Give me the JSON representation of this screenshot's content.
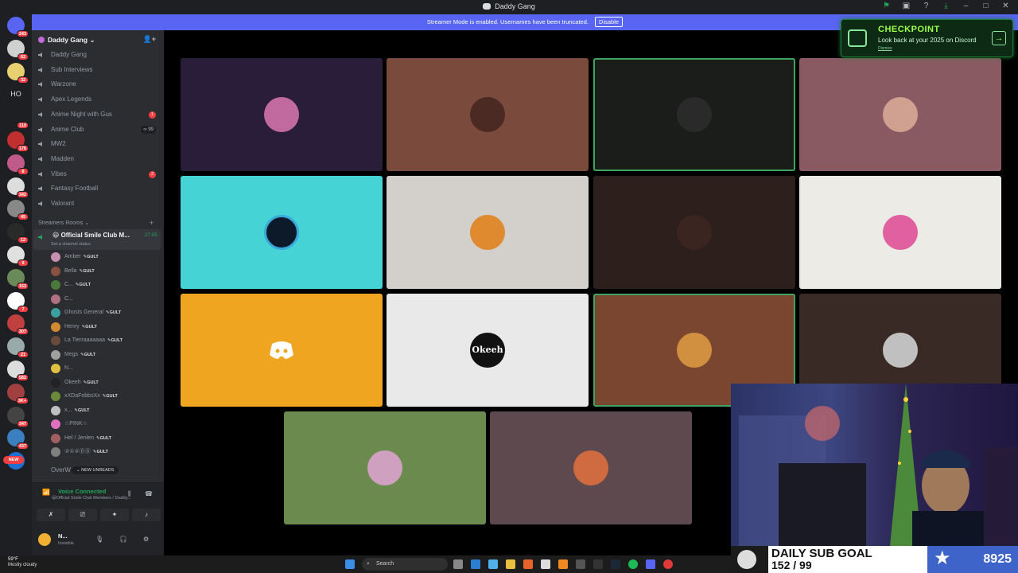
{
  "window": {
    "title": "Daddy Gang"
  },
  "streamer_bar": {
    "text": "Streamer Mode is enabled. Usernames have been truncated.",
    "disable_label": "Disable"
  },
  "rail": {
    "badges": [
      "243",
      "62",
      "32",
      "HO",
      "110",
      "176",
      "8",
      "342",
      "45",
      "12",
      "9",
      "153",
      "7",
      "307",
      "21",
      "582",
      "3K+",
      "347",
      "437",
      "NEW"
    ]
  },
  "guild": {
    "name": "Daddy Gang",
    "chevron": "chevron-down-icon"
  },
  "channels": [
    {
      "name": "Daddy Gang"
    },
    {
      "name": "Sub Interviews"
    },
    {
      "name": "Warzone"
    },
    {
      "name": "Apex Legends"
    },
    {
      "name": "Anime Night with Gus",
      "badge": "1"
    },
    {
      "name": "Anime Club",
      "pill": "99"
    },
    {
      "name": "MW2"
    },
    {
      "name": "Madden"
    },
    {
      "name": "Vibes",
      "badge": "2"
    },
    {
      "name": "Fantasy Football"
    },
    {
      "name": "Valorant"
    }
  ],
  "category": {
    "name": "Streamers Rooms",
    "plus": "+"
  },
  "active_channel": {
    "name": "Official Smile Club M...",
    "time": "27:05",
    "status": "Set a channel status"
  },
  "voice_users": [
    {
      "name": "Amber",
      "tag": "GULT",
      "color": "#c78fb0"
    },
    {
      "name": "Bella",
      "tag": "GULT",
      "color": "#8a5040"
    },
    {
      "name": "C...",
      "tag": "GULT",
      "color": "#4a7a3a"
    },
    {
      "name": "C...",
      "tag": "",
      "color": "#b07080"
    },
    {
      "name": "Ghosts General",
      "tag": "GULT",
      "color": "#3aa0a0"
    },
    {
      "name": "Henry",
      "tag": "GULT",
      "color": "#d08a30"
    },
    {
      "name": "La Tierraaaaaaa",
      "tag": "GULT",
      "color": "#6a4a3a"
    },
    {
      "name": "Megs",
      "tag": "GULT",
      "color": "#a0a0a0"
    },
    {
      "name": "N...",
      "tag": "",
      "color": "#e0c040"
    },
    {
      "name": "Okeeh",
      "tag": "GULT",
      "color": "#222222"
    },
    {
      "name": "xXDaFobbsXx",
      "tag": "GULT",
      "color": "#6a8a3a"
    },
    {
      "name": "x...",
      "tag": "GULT",
      "color": "#c0c0c0"
    },
    {
      "name": "☆PINK☆",
      "tag": "",
      "color": "#e070c0"
    },
    {
      "name": "Hel / Jenlen",
      "tag": "GULT",
      "color": "#a06060"
    },
    {
      "name": "②①②⓪⓪",
      "tag": "GULT",
      "color": "#808080"
    }
  ],
  "overw": "OverW",
  "new_unreads": "NEW UNREADS",
  "voice": {
    "status": "Voice Connected",
    "location": "Official Smile Club Members / Daddy..."
  },
  "user": {
    "name": "N...",
    "status": "Invisible"
  },
  "tiles": [
    {
      "bg": "#2a1d3a",
      "av": "#c06aa0",
      "speaking": false
    },
    {
      "bg": "#7a4a3d",
      "av": "#4a2a22",
      "speaking": false
    },
    {
      "bg": "#1b1d1b",
      "av": "#2a2a2a",
      "speaking": true
    },
    {
      "bg": "#8a5a62",
      "av": "#d0a090",
      "speaking": false
    },
    {
      "bg": "#45d3d6",
      "av": "#0d1a2a",
      "speaking": false
    },
    {
      "bg": "#d3cfcb",
      "av": "#e08a30",
      "speaking": false
    },
    {
      "bg": "#2d1f1b",
      "av": "#3a2520",
      "speaking": false
    },
    {
      "bg": "#ecebe6",
      "av": "#e060a0",
      "speaking": false
    },
    {
      "bg": "#f0a521",
      "av": "#f0a521",
      "speaking": false
    },
    {
      "bg": "#e9e9e9",
      "av": "#111111",
      "speaking": false
    },
    {
      "bg": "#7a4630",
      "av": "#d09040",
      "speaking": true
    },
    {
      "bg": "#3a2a25",
      "av": "#c0c0c0",
      "speaking": false
    },
    {
      "bg": "#6a8a4e",
      "av": "#d0a0c0",
      "speaking": false
    },
    {
      "bg": "#5e4a4e",
      "av": "#d06a40",
      "speaking": false
    }
  ],
  "okeeh_logo": "Okeeh",
  "checkpoint": {
    "title": "CHECKPOINT",
    "subtitle": "Look back at your 2025 on Discord",
    "dismiss": "Dismiss"
  },
  "overlay": {
    "goal_title": "DAILY SUB GOAL",
    "goal_progress": "152 / 99",
    "count": "8925"
  },
  "taskbar": {
    "temp": "59°F",
    "weather": "Mostly cloudy",
    "search_placeholder": "Search"
  }
}
